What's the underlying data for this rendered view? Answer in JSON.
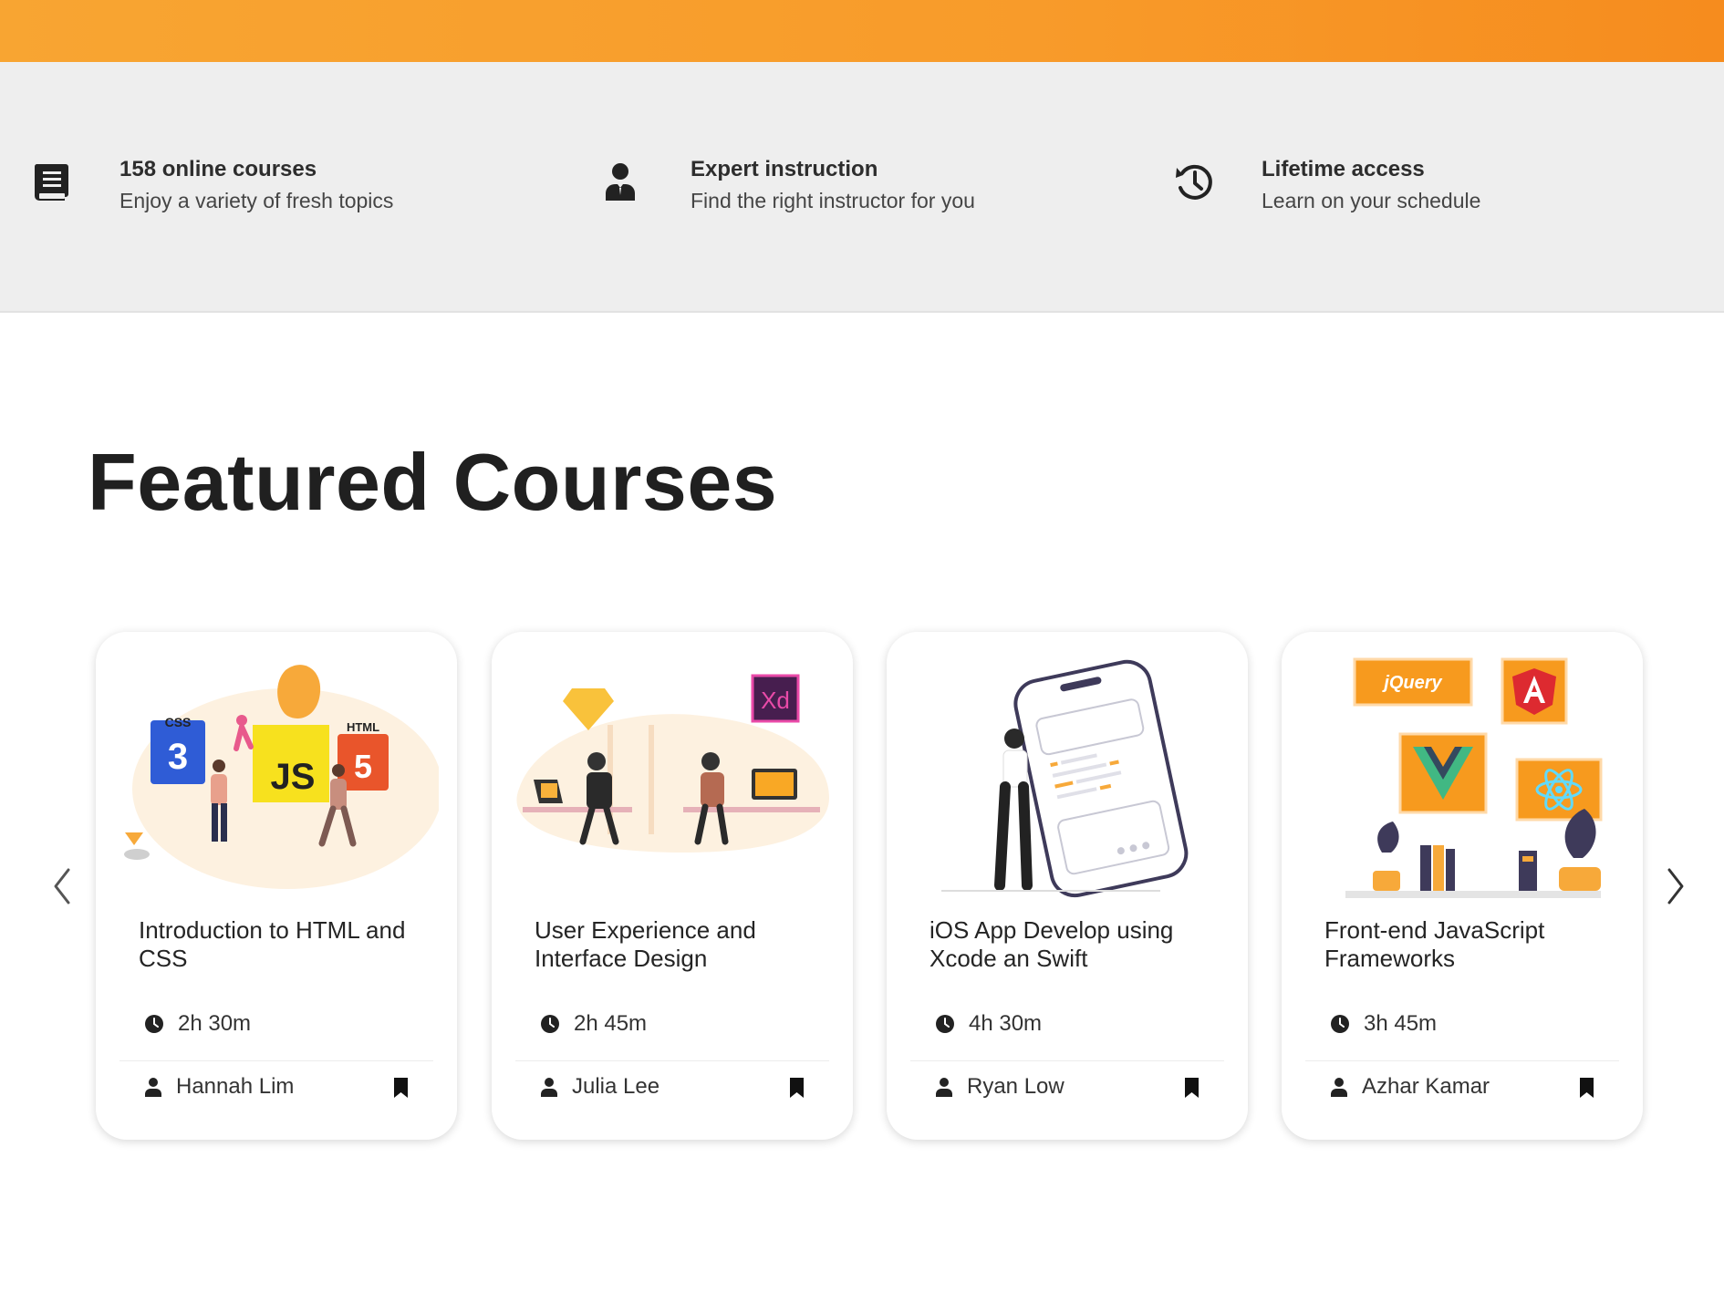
{
  "features": [
    {
      "icon": "book-icon",
      "title": "158 online courses",
      "desc": "Enjoy a variety of fresh topics"
    },
    {
      "icon": "instructor-icon",
      "title": "Expert instruction",
      "desc": "Find the right instructor for you"
    },
    {
      "icon": "history-icon",
      "title": "Lifetime access",
      "desc": "Learn on your schedule"
    }
  ],
  "section": {
    "title": "Featured Courses"
  },
  "carousel": {
    "prev_icon": "chevron-left-icon",
    "next_icon": "chevron-right-icon"
  },
  "courses": [
    {
      "title": "Introduction to HTML and CSS",
      "duration": "2h 30m",
      "author": "Hannah Lim",
      "illustration_labels": [
        "CSS",
        "JS",
        "HTML"
      ]
    },
    {
      "title": "User Experience and Interface Design",
      "duration": "2h 45m",
      "author": "Julia Lee",
      "illustration_labels": [
        "Xd"
      ]
    },
    {
      "title": "iOS App Develop using Xcode an Swift",
      "duration": "4h 30m",
      "author": "Ryan Low",
      "illustration_labels": []
    },
    {
      "title": "Front-end JavaScript Frameworks",
      "duration": "3h 45m",
      "author": "Azhar Kamar",
      "illustration_labels": [
        "jQuery"
      ]
    }
  ],
  "colors": {
    "brand": "#f8a532",
    "accent_orange": "#f79a1e",
    "feature_bg": "#eeeeee",
    "text_dark": "#202020"
  }
}
